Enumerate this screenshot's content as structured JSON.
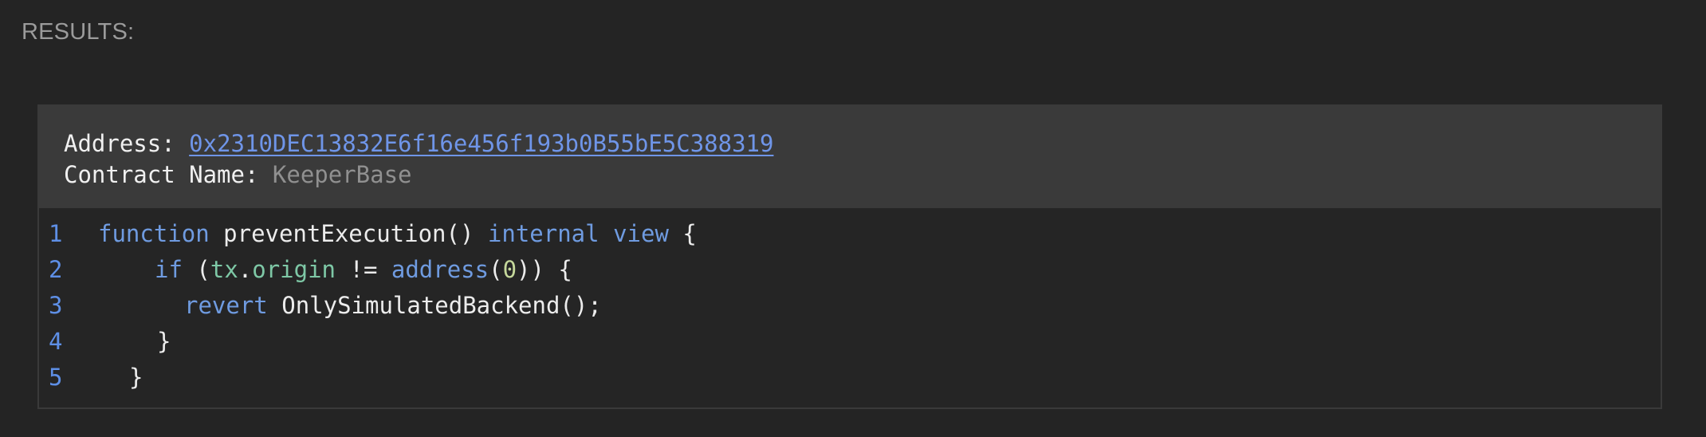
{
  "results_label": "RESULTS:",
  "contract": {
    "address_label": "Address:",
    "address_value": "0x2310DEC13832E6f16e456f193b0B55bE5C388319",
    "name_label": "Contract Name:",
    "name_value": "KeeperBase"
  },
  "code": {
    "line_numbers": [
      "1",
      "2",
      "3",
      "4",
      "5"
    ],
    "l1_kw_function": "function",
    "l1_name": "preventExecution()",
    "l1_kw_internal": "internal",
    "l1_kw_view": "view",
    "l1_brace": "{",
    "l2_kw_if": "if",
    "l2_paren_open": "(",
    "l2_tx": "tx",
    "l2_dot": ".",
    "l2_origin": "origin",
    "l2_op": "!=",
    "l2_address": "address",
    "l2_p_open": "(",
    "l2_zero": "0",
    "l2_tail": ")) {",
    "l3_kw_revert": "revert",
    "l3_call": "OnlySimulatedBackend();",
    "l4_brace": "}",
    "l5_brace": "}"
  },
  "colors": {
    "background": "#242424",
    "header_background": "#3a3a3a",
    "link": "#6f95e8",
    "keyword": "#6f9be0",
    "line_number": "#5e8fe6"
  }
}
